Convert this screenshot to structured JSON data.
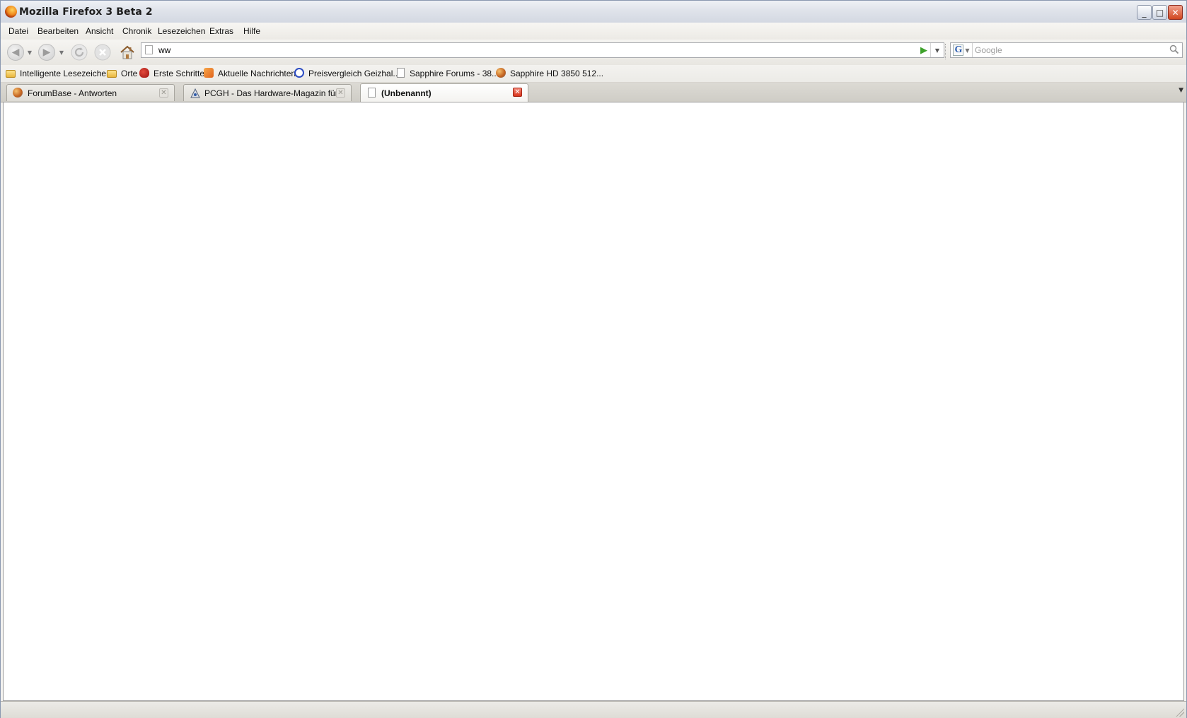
{
  "window": {
    "title": "Mozilla Firefox 3 Beta 2",
    "controls": {
      "minimize": "_",
      "maximize": "□",
      "close": "✕"
    }
  },
  "menu": [
    {
      "label": "Datei",
      "accel": "D"
    },
    {
      "label": "Bearbeiten",
      "accel": "B"
    },
    {
      "label": "Ansicht",
      "accel": "A"
    },
    {
      "label": "Chronik",
      "accel": "C"
    },
    {
      "label": "Lesezeichen",
      "accel": "L"
    },
    {
      "label": "Extras",
      "accel": "E"
    },
    {
      "label": "Hilfe",
      "accel": "H"
    }
  ],
  "navigation": {
    "back_icon": "back-arrow-icon",
    "forward_icon": "forward-arrow-icon",
    "reload_icon": "reload-icon",
    "stop_icon": "stop-icon",
    "home_icon": "home-icon",
    "url_value": "ww",
    "go_icon": "go-arrow-icon"
  },
  "search": {
    "engine": "G",
    "placeholder": "Google"
  },
  "bookmarks": [
    {
      "label": "Intelligente Lesezeichen",
      "icon": "folder-icon"
    },
    {
      "label": "Orte",
      "icon": "folder-icon"
    },
    {
      "label": "Erste Schritte",
      "icon": "redhat-icon"
    },
    {
      "label": "Aktuelle Nachrichten",
      "icon": "rss-icon"
    },
    {
      "label": "Preisvergleich Geizhal...",
      "icon": "geizhals-icon"
    },
    {
      "label": "Sapphire Forums - 38...",
      "icon": "page-icon"
    },
    {
      "label": "Sapphire HD 3850 512...",
      "icon": "sapphire-icon"
    }
  ],
  "tabs": [
    {
      "label": "ForumBase - Antworten",
      "selected": false
    },
    {
      "label": "PCGH - Das Hardware-Magazin für PC-...",
      "selected": false
    },
    {
      "label": "(Unbenannt)",
      "selected": true
    }
  ],
  "status": {
    "text": ""
  },
  "colors": {
    "titlebar": "#dfe3ea",
    "chrome": "#f3f2ef",
    "close_button": "#d0461f",
    "go_button": "#3da12a"
  }
}
